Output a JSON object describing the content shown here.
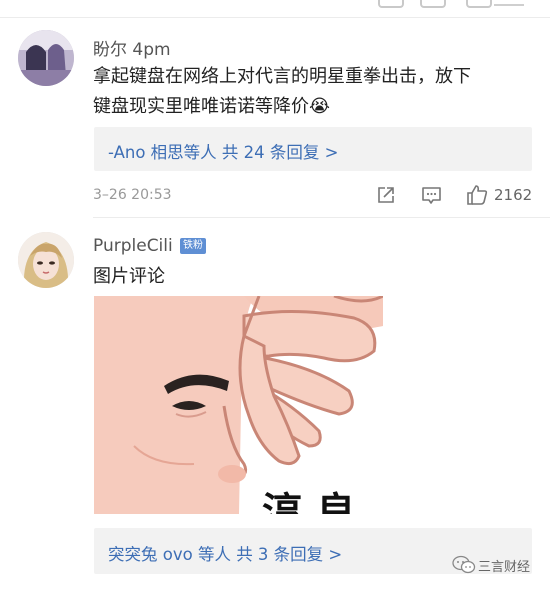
{
  "comments": [
    {
      "username": "盼尔",
      "time_suffix": "4pm",
      "text_line1": "拿起键盘在网络上对代言的明星重拳出击，放下",
      "text_line2": "键盘现实里唯唯诺诺等降价",
      "emoji": "😭",
      "reply_summary": "-Ano 相思等人  共 24 条回复 >",
      "date": "3–26 20:53",
      "like_count": "2162"
    },
    {
      "username": "PurpleCili",
      "badge": "铁粉",
      "text": "图片评论",
      "image_caption": "淳 良",
      "reply_summary": "突突兔 ovo 等人  共 3 条回复 >"
    }
  ],
  "watermark": {
    "text": "三言财经"
  },
  "icons": [
    "share-icon",
    "comment-icon",
    "thumbs-up-icon",
    "wechat-logo-icon"
  ],
  "colors": {
    "link": "#3d6eb5",
    "reply_bg": "#f2f2f2",
    "badge": "#5f8fd4"
  }
}
